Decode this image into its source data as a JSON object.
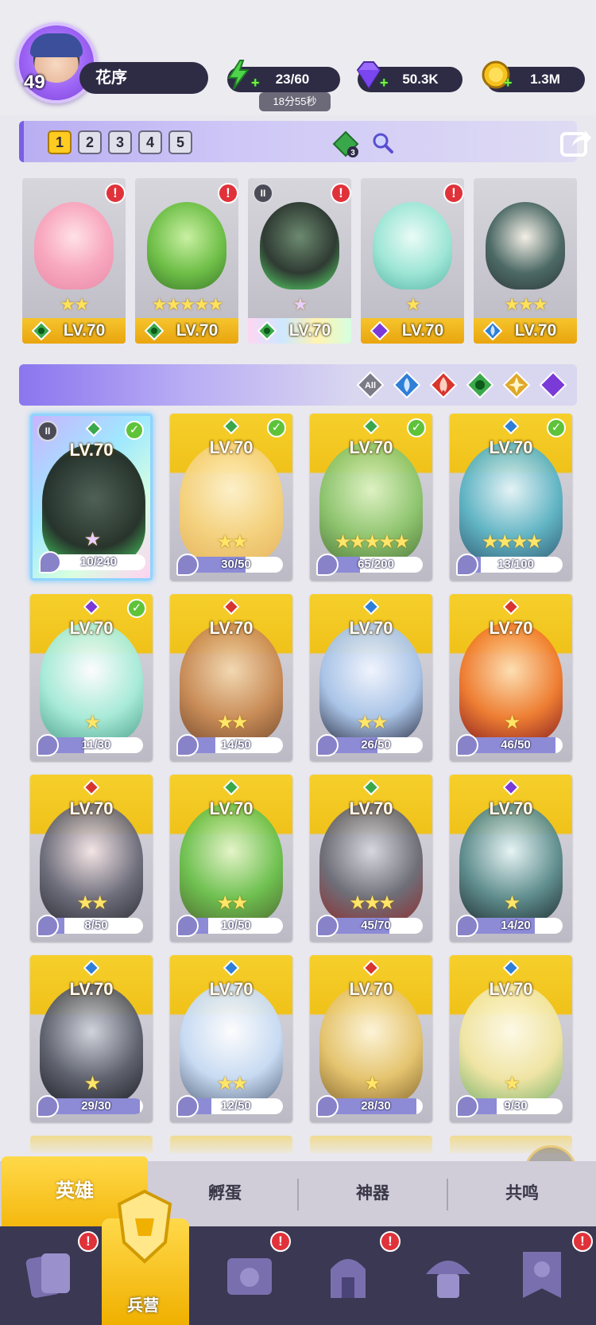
{
  "player": {
    "level": "49",
    "name": "花序"
  },
  "resources": {
    "stamina": "23/60",
    "stamina_timer": "18分55秒",
    "gems": "50.3K",
    "gold": "1.3M"
  },
  "team": {
    "tabs": [
      "1",
      "2",
      "3",
      "4",
      "5"
    ],
    "active_tab": "1",
    "gem_count": "3",
    "members": [
      {
        "level": "LV.70",
        "stars": "★★",
        "element": "green",
        "alert": true,
        "art": "pink-flower-girl"
      },
      {
        "level": "LV.70",
        "stars": "★★★★★",
        "element": "green",
        "alert": true,
        "art": "green-knight"
      },
      {
        "level": "LV.70",
        "stars": "★",
        "element": "green",
        "alert": true,
        "rank": "II",
        "art": "dark-forest-beast"
      },
      {
        "level": "LV.70",
        "stars": "★",
        "element": "purple",
        "alert": true,
        "art": "bunny-magician"
      },
      {
        "level": "LV.70",
        "stars": "★★★",
        "element": "blue",
        "alert": false,
        "art": "eagle-warrior"
      }
    ]
  },
  "filters": {
    "all_label": "All",
    "elements": [
      "blue",
      "red",
      "green",
      "yellow",
      "purple"
    ]
  },
  "heroes": [
    {
      "level": "LV.70",
      "element": "green",
      "progress": "10/240",
      "pct": 0.04,
      "stars": "★",
      "checked": true,
      "rank": "II",
      "selected": true,
      "art": "dark"
    },
    {
      "level": "LV.70",
      "element": "green",
      "progress": "30/50",
      "pct": 0.6,
      "stars": "★★",
      "checked": true,
      "art": "blonde"
    },
    {
      "level": "LV.70",
      "element": "green",
      "progress": "65/200",
      "pct": 0.33,
      "stars": "★★★★★",
      "checked": true,
      "art": "green-knight"
    },
    {
      "level": "LV.70",
      "element": "blue",
      "progress": "13/100",
      "pct": 0.13,
      "stars": "★★★★",
      "checked": true,
      "art": "teal-hair"
    },
    {
      "level": "LV.70",
      "element": "purple",
      "progress": "11/30",
      "pct": 0.37,
      "stars": "★",
      "checked": true,
      "art": "mint-jester"
    },
    {
      "level": "LV.70",
      "element": "red",
      "progress": "14/50",
      "pct": 0.28,
      "stars": "★★",
      "checked": false,
      "art": "mushroom"
    },
    {
      "level": "LV.70",
      "element": "blue",
      "progress": "26/50",
      "pct": 0.52,
      "stars": "★★",
      "checked": false,
      "art": "silver-hair"
    },
    {
      "level": "LV.70",
      "element": "red",
      "progress": "46/50",
      "pct": 0.92,
      "stars": "★",
      "checked": false,
      "art": "fire-rocker"
    },
    {
      "level": "LV.70",
      "element": "red",
      "progress": "8/50",
      "pct": 0.16,
      "stars": "★★",
      "checked": false,
      "art": "dark-maid"
    },
    {
      "level": "LV.70",
      "element": "green",
      "progress": "10/50",
      "pct": 0.2,
      "stars": "★★",
      "checked": false,
      "art": "leaf-tea"
    },
    {
      "level": "LV.70",
      "element": "green",
      "progress": "45/70",
      "pct": 0.64,
      "stars": "★★★",
      "checked": false,
      "art": "wolf-mech"
    },
    {
      "level": "LV.70",
      "element": "purple",
      "progress": "14/20",
      "pct": 0.7,
      "stars": "★",
      "checked": false,
      "art": "masked-witch"
    },
    {
      "level": "LV.70",
      "element": "blue",
      "progress": "29/30",
      "pct": 0.97,
      "stars": "★",
      "checked": false,
      "art": "shadow-knight"
    },
    {
      "level": "LV.70",
      "element": "blue",
      "progress": "12/50",
      "pct": 0.24,
      "stars": "★★",
      "checked": false,
      "art": "ice-maiden"
    },
    {
      "level": "LV.70",
      "element": "red",
      "progress": "28/30",
      "pct": 0.93,
      "stars": "★",
      "checked": false,
      "art": "golden-king"
    },
    {
      "level": "LV.70",
      "element": "blue",
      "progress": "9/30",
      "pct": 0.3,
      "stars": "★",
      "checked": false,
      "art": "leaf-priestess"
    }
  ],
  "sub_tabs": [
    "英雄",
    "孵蛋",
    "神器",
    "共鸣"
  ],
  "bottom_nav": {
    "active_label": "兵营",
    "items": [
      "cards",
      "barracks",
      "spellbook",
      "castle",
      "mushroom-house",
      "banner"
    ]
  },
  "colors": {
    "accent_yellow": "#f4b70c",
    "panel_dark": "#2e2b45",
    "element_green": "#3aa84a",
    "element_blue": "#2f7fd8",
    "element_red": "#d8352f",
    "element_purple": "#7a3ad8",
    "element_yellow": "#e0a82a"
  }
}
